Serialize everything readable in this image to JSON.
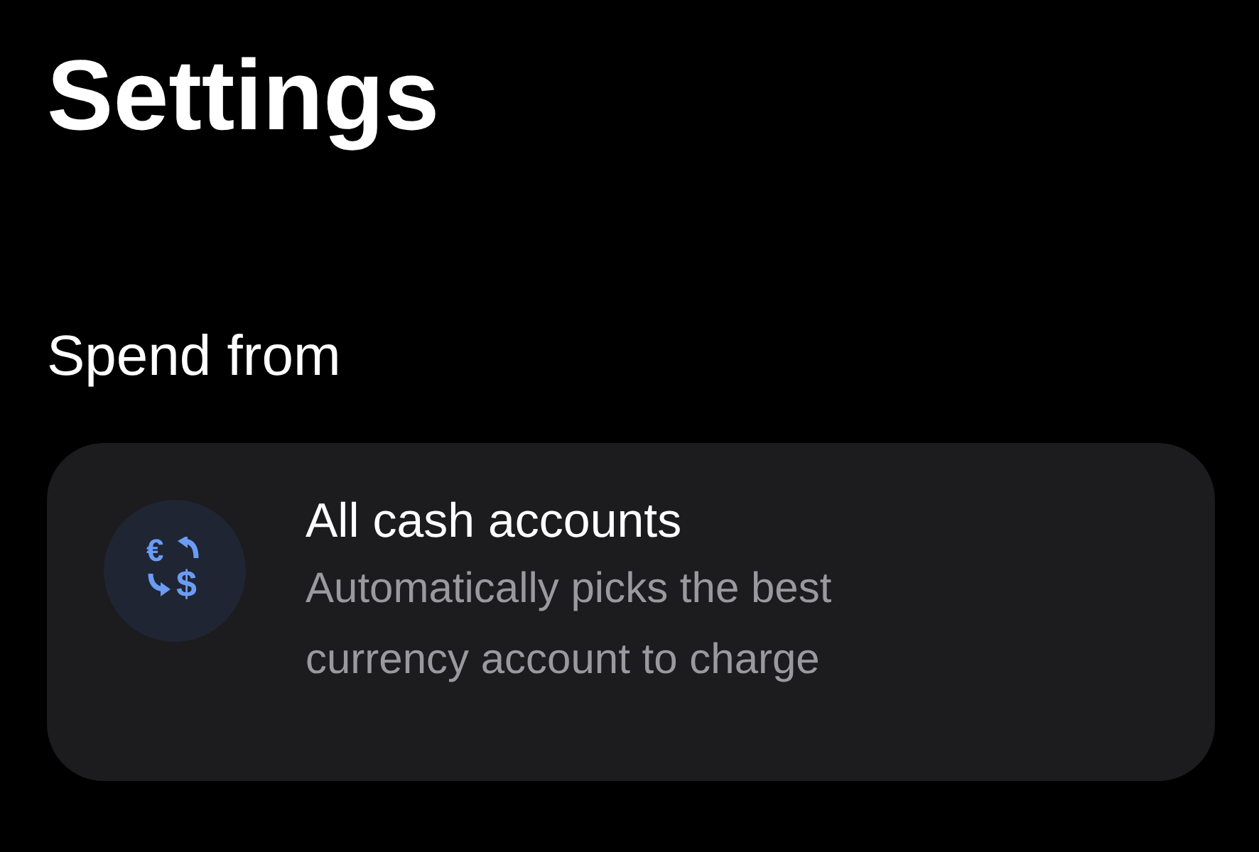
{
  "title": "Settings",
  "section": "Spend from",
  "option": {
    "title": "All cash accounts",
    "subtitle": "Automatically picks the best currency account to charge",
    "symbols": [
      "€",
      "$"
    ]
  }
}
